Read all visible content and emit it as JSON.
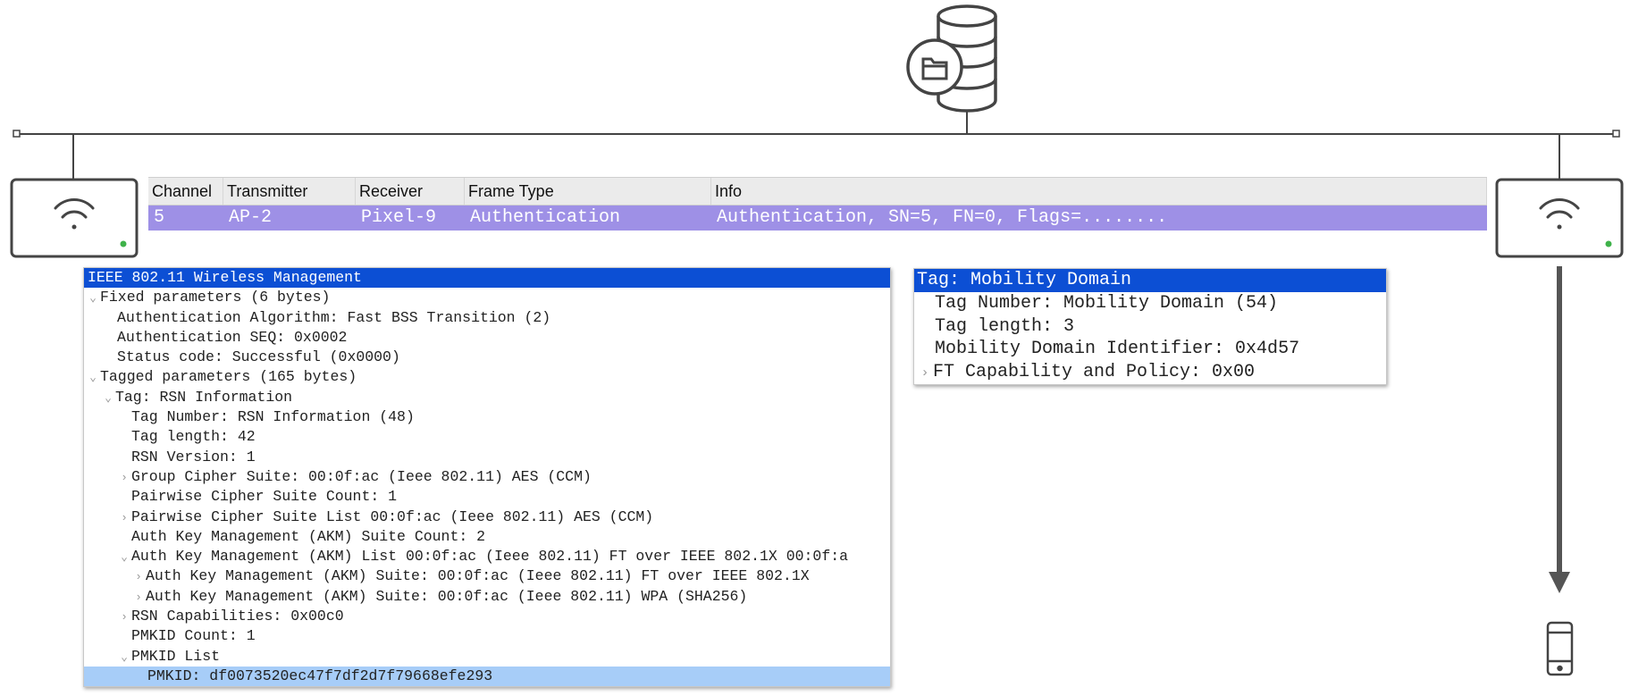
{
  "packet_list": {
    "columns": [
      "Channel",
      "Transmitter",
      "Receiver",
      "Frame Type",
      "Info"
    ],
    "row": {
      "channel": "5",
      "transmitter": "AP-2",
      "receiver": "Pixel-9",
      "frame_type": "Authentication",
      "info": "Authentication, SN=5, FN=0, Flags=........"
    }
  },
  "detail_tree": {
    "header": "IEEE 802.11 Wireless Management",
    "fixed_params": "Fixed parameters (6 bytes)",
    "auth_algorithm": "Authentication Algorithm: Fast BSS Transition (2)",
    "auth_seq": "Authentication SEQ: 0x0002",
    "status_code": "Status code: Successful (0x0000)",
    "tagged_params": "Tagged parameters (165 bytes)",
    "rsn_tag": "Tag: RSN Information",
    "tag_number": "Tag Number: RSN Information (48)",
    "tag_length": "Tag length: 42",
    "rsn_version": "RSN Version: 1",
    "group_cipher": "Group Cipher Suite: 00:0f:ac (Ieee 802.11) AES (CCM)",
    "pairwise_count": "Pairwise Cipher Suite Count: 1",
    "pairwise_list": "Pairwise Cipher Suite List 00:0f:ac (Ieee 802.11) AES (CCM)",
    "akm_count": "Auth Key Management (AKM) Suite Count: 2",
    "akm_list": "Auth Key Management (AKM) List 00:0f:ac (Ieee 802.11) FT over IEEE 802.1X 00:0f:a",
    "akm_suite_1": "Auth Key Management (AKM) Suite: 00:0f:ac (Ieee 802.11) FT over IEEE 802.1X",
    "akm_suite_2": "Auth Key Management (AKM) Suite: 00:0f:ac (Ieee 802.11) WPA (SHA256)",
    "rsn_capabilities": "RSN Capabilities: 0x00c0",
    "pmkid_count": "PMKID Count: 1",
    "pmkid_list": "PMKID List",
    "pmkid": "PMKID: df0073520ec47f7df2d7f79668efe293"
  },
  "mobility_tree": {
    "header": "Tag: Mobility Domain",
    "tag_number": "Tag Number: Mobility Domain (54)",
    "tag_length": "Tag length: 3",
    "mdid": "Mobility Domain Identifier: 0x4d57",
    "ft_capability": "FT Capability and Policy: 0x00"
  },
  "icons": {
    "server": "database-server-icon",
    "ap_left": "wifi-access-point-icon",
    "ap_right": "wifi-access-point-icon",
    "client": "smartphone-icon",
    "arrow": "arrow-down-icon"
  },
  "colors": {
    "row_highlight": "#9e90e6",
    "selection": "#0c4fd4",
    "pmkid_highlight": "#a7cdf8",
    "ap_status_led": "#3fb24a",
    "diagram_stroke": "#444444"
  }
}
